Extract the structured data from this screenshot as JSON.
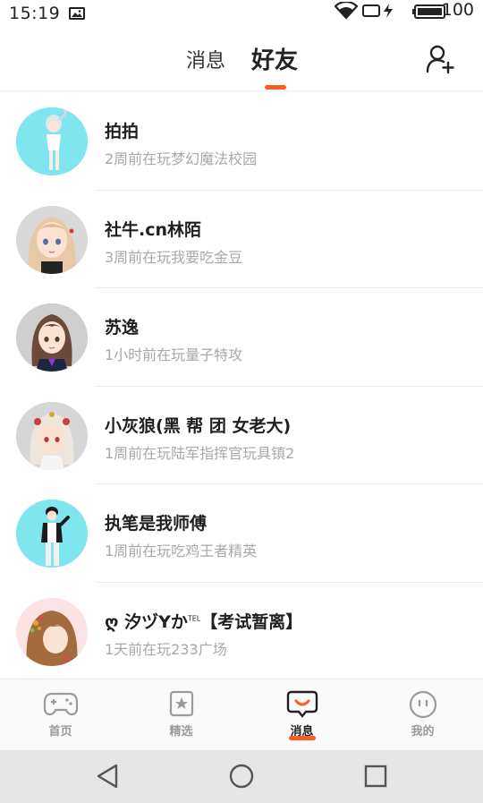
{
  "status_bar": {
    "time": "15:19",
    "battery_level": "100"
  },
  "header": {
    "tabs": [
      {
        "label": "消息",
        "active": false
      },
      {
        "label": "好友",
        "active": true
      }
    ],
    "accent_color": "#ff5a1f",
    "add_friend_icon": "add-friend-icon"
  },
  "friends": [
    {
      "name": "拍拍",
      "status": "2周前在玩梦幻魔法校园",
      "avatar_bg": "#7fe6f0"
    },
    {
      "name": "社牛.cn林陌",
      "status": "3周前在玩我要吃金豆",
      "avatar_bg": "#d9d9d9"
    },
    {
      "name": "苏逸",
      "status": "1小时前在玩量子特攻",
      "avatar_bg": "#cfcfcf"
    },
    {
      "name": "小灰狼(黑 帮 团 女老大)",
      "status": "1周前在玩陆军指挥官玩具镇2",
      "avatar_bg": "#d6d6d6"
    },
    {
      "name": "执笔是我师傅",
      "status": "1周前在玩吃鸡王者精英",
      "avatar_bg": "#7fe6f0"
    },
    {
      "name": "ღ 汐ヅYか",
      "name_sup": "TEL",
      "name_suffix": "【考试暂离】",
      "status": "1天前在玩233广场",
      "avatar_bg": "#fde4e4"
    }
  ],
  "bottom_nav": [
    {
      "label": "首页",
      "icon": "gamepad-icon",
      "active": false
    },
    {
      "label": "精选",
      "icon": "star-card-icon",
      "active": false
    },
    {
      "label": "消息",
      "icon": "chat-bubble-icon",
      "active": true
    },
    {
      "label": "我的",
      "icon": "smiley-icon",
      "active": false
    }
  ],
  "system_nav": [
    "back-icon",
    "home-icon",
    "recents-icon"
  ]
}
